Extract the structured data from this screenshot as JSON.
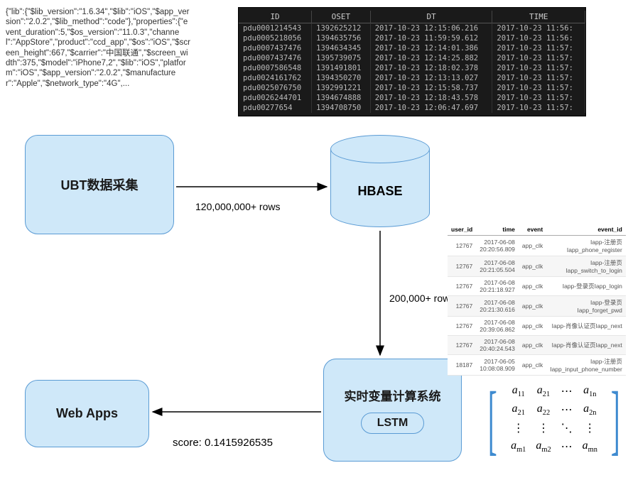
{
  "json_snippet": "{\"lib\":{\"$lib_version\":\"1.6.34\",\"$lib\":\"iOS\",\"$app_version\":\"2.0.2\",\"$lib_method\":\"code\"},\"properties\":{\"event_duration\":5,\"$os_version\":\"11.0.3\",\"channel\":\"AppStore\",\"product\":\"ccd_app\",\"$os\":\"iOS\",\"$screen_height\":667,\"$carrier\":\"中国联通\",\"$screen_width\":375,\"$model\":\"iPhone7,2\",\"$lib\":\"iOS\",\"platform\":\"iOS\",\"$app_version\":\"2.0.2\",\"$manufacturer\":\"Apple\",\"$network_type\":\"4G\",...",
  "terminal": {
    "headers": [
      "ID",
      "OSET",
      "DT",
      "TIME"
    ],
    "rows": [
      [
        "pdu0001214543",
        "1392625212",
        "2017-10-23 12:15:06.216",
        "2017-10-23 11:56:"
      ],
      [
        "pdu0005218056",
        "1394635756",
        "2017-10-23 11:59:59.612",
        "2017-10-23 11:56:"
      ],
      [
        "pdu0007437476",
        "1394634345",
        "2017-10-23 12:14:01.386",
        "2017-10-23 11:57:"
      ],
      [
        "pdu0007437476",
        "1395739075",
        "2017-10-23 12:14:25.882",
        "2017-10-23 11:57:"
      ],
      [
        "pdu0007586548",
        "1391491801",
        "2017-10-23 12:18:02.378",
        "2017-10-23 11:57:"
      ],
      [
        "pdu0024161762",
        "1394350270",
        "2017-10-23 12:13:13.027",
        "2017-10-23 11:57:"
      ],
      [
        "pdu0025076750",
        "1392991221",
        "2017-10-23 12:15:58.737",
        "2017-10-23 11:57:"
      ],
      [
        "pdu0026244701",
        "1394674888",
        "2017-10-23 12:18:43.578",
        "2017-10-23 11:57:"
      ],
      [
        "pdu00277654",
        "1394708750",
        "2017-10-23 12:06:47.697",
        "2017-10-23 11:57:"
      ]
    ]
  },
  "nodes": {
    "ubt": "UBT数据采集",
    "hbase": "HBASE",
    "realtime": "实时变量计算系统",
    "lstm": "LSTM",
    "webapps": "Web Apps"
  },
  "labels": {
    "rows1": "120,000,000+ rows",
    "rows2": "200,000+ rows",
    "score": "score: 0.1415926535"
  },
  "event_table": {
    "headers": [
      "user_id",
      "time",
      "event",
      "event_id"
    ],
    "rows": [
      [
        "12767",
        "2017-06-08 20:20:56.809",
        "app_clk",
        "Iapp-注册页 Iapp_phone_register"
      ],
      [
        "12767",
        "2017-06-08 20:21:05.504",
        "app_clk",
        "Iapp-注册页 Iapp_switch_to_login"
      ],
      [
        "12767",
        "2017-06-08 20:21:18.927",
        "app_clk",
        "Iapp-登录页Iapp_login"
      ],
      [
        "12767",
        "2017-06-08 20:21:30.616",
        "app_clk",
        "Iapp-登录页Iapp_forget_pwd"
      ],
      [
        "12767",
        "2017-06-08 20:39:06.862",
        "app_clk",
        "Iapp-肖像认证页Iapp_next"
      ],
      [
        "12767",
        "2017-06-08 20:40:24.543",
        "app_clk",
        "Iapp-肖像认证页Iapp_next"
      ],
      [
        "18187",
        "2017-06-05 10:08:08.909",
        "app_clk",
        "Iapp-注册页 Iapp_input_phone_number"
      ]
    ]
  },
  "matrix": {
    "cells": [
      [
        "a",
        "11",
        "a",
        "21",
        "⋯",
        "a",
        "1n"
      ],
      [
        "a",
        "21",
        "a",
        "22",
        "⋯",
        "a",
        "2n"
      ],
      [
        "⋮",
        "",
        "⋮",
        "",
        "⋱",
        "⋮",
        ""
      ],
      [
        "a",
        "m1",
        "a",
        "m2",
        "⋯",
        "a",
        "mn"
      ]
    ]
  }
}
